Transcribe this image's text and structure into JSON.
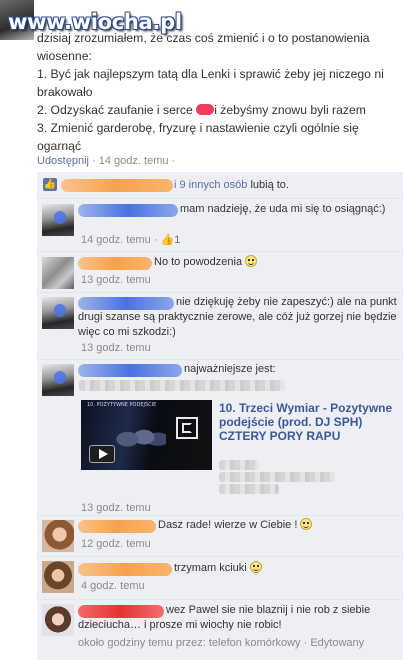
{
  "watermark": "www.wiocha.pl",
  "post": {
    "lines": [
      "dzisiaj zrozumiałem, że czas coś zmienić i o to postanowienia wiosenne:",
      "1. Być jak najlepszym tatą dla Lenki i sprawić żeby jej niczego ni brakowało",
      "3. Zmienić garderobę, fryzurę i nastawienie czyli ogólnie się ogarnąć"
    ],
    "line2_before": "2. Odzyskać zaufanie i serce",
    "line2_after": "i żebyśmy znowu byli razem",
    "share_link": "Udostępnij",
    "separator": " · ",
    "time": "14 godz. temu",
    "tail_dot": "·"
  },
  "likes": {
    "text": "i 9 innych osób",
    "suffix": " lubią to."
  },
  "comments": [
    {
      "text": "mam nadzieję, że uda mi się to osiągnąć:)",
      "time": "14 godz. temu",
      "likes": "1"
    },
    {
      "text": "No to powodzenia",
      "time": "13 godz. temu"
    },
    {
      "text": "nie dziękuję żeby nie zapeszyć:) ale na punkt drugi szanse są praktycznie zerowe, ale cóż już gorzej nie będzie więc co mi szkodzi:)",
      "time": "13 godz. temu"
    },
    {
      "text": "najważniejsze jest:",
      "time": "13 godz. temu"
    },
    {
      "text": "Dasz rade! wierze w Ciebie !",
      "time": "12 godz. temu"
    },
    {
      "text": "trzymam kciuki",
      "time": "4 godz. temu"
    },
    {
      "text": "wez Pawel sie nie blaznij i nie rob z siebie dzieciucha… i prosze mi wiochy nie robic!",
      "time": "około godziny temu przez: telefon komórkowy",
      "edited": "Edytowany"
    }
  ],
  "video": {
    "title": "10. Trzeci Wymiar - Pozytywne podejście (prod. DJ SPH) CZTERY PORY RAPU",
    "thumb_caption": "10. POZYTYWNE PODEJŚCIE"
  }
}
